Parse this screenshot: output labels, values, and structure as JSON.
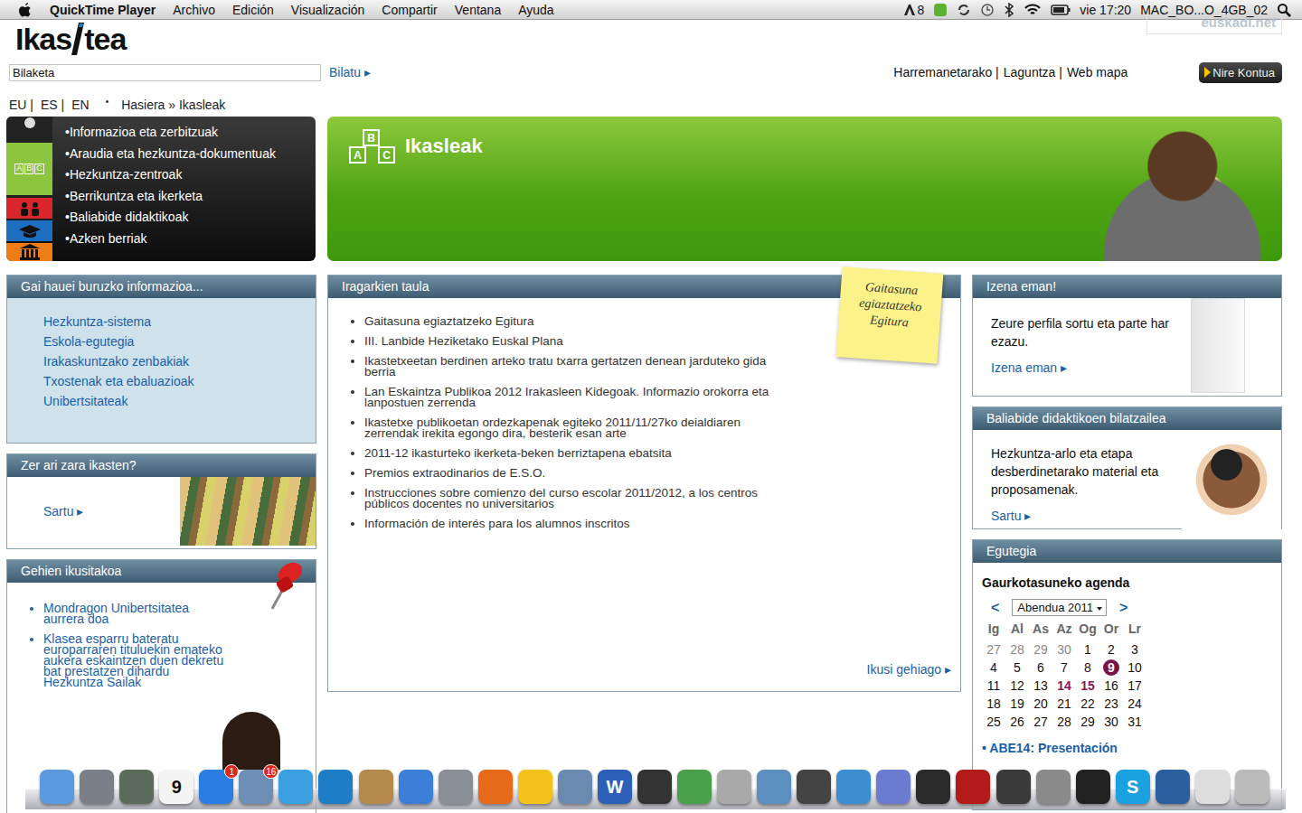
{
  "menubar": {
    "app": "QuickTime Player",
    "menus": [
      "Archivo",
      "Edición",
      "Visualización",
      "Compartir",
      "Ventana",
      "Ayuda"
    ],
    "adobe_count": "8",
    "clock": "vie 17:20",
    "user": "MAC_BO...O_4GB_02"
  },
  "header": {
    "logo_left": "Ikas",
    "logo_right": "tea",
    "partner": "euskadi.net",
    "search_value": "Bilaketa",
    "search_button": "Bilatu ▸",
    "links": [
      "Harremanetarako |",
      "Laguntza |",
      "Web mapa"
    ],
    "account_button": "Nire Kontua"
  },
  "languages": [
    "EU |",
    "ES |",
    "EN"
  ],
  "bullet": "•",
  "breadcrumb": "Hasiera » Ikasleak",
  "nav": [
    "•Informazioa eta zerbitzuak",
    "•Araudia eta hezkuntza-dokumentuak",
    "•Hezkuntza-zentroak",
    "•Berrikuntza eta ikerketa",
    "•Baliabide didaktikoak",
    "•Azken berriak"
  ],
  "banner": {
    "title": "Ikasleak",
    "icon_letters": [
      "A",
      "B",
      "C"
    ]
  },
  "info_panel": {
    "title": "Gai hauei buruzko informazioa...",
    "links": [
      "Hezkuntza-sistema",
      "Eskola-egutegia",
      "Irakaskuntzako zenbakiak",
      "Txostenak eta ebaluazioak",
      "Unibertsitateak"
    ]
  },
  "study_panel": {
    "title": "Zer ari zara ikasten?",
    "link": "Sartu ▸"
  },
  "popular_panel": {
    "title": "Gehien ikusitakoa",
    "links": [
      "Mondragon Unibertsitatea aurrera doa",
      "Klasea esparru bateratu europarraren tituluekin emateko aukera eskaintzen duen dekretu bat prestatzen dihardu Hezkuntza Sailak"
    ]
  },
  "notices": {
    "title": "Iragarkien taula",
    "note": "Gaitasuna egiaztatzeko Egitura",
    "items": [
      "Gaitasuna egiaztatzeko Egitura",
      "III. Lanbide Heziketako Euskal Plana",
      "Ikastetxeetan berdinen arteko tratu txarra gertatzen denean jarduteko gida berria",
      "Lan Eskaintza Publikoa 2012 Irakasleen Kidegoak. Informazio orokorra eta lanpostuen zerrenda",
      "Ikastetxe publikoetan ordezkapenak egiteko 2011/11/27ko deialdiaren zerrendak irekita egongo dira, besterik esan arte",
      "2011-12 ikasturteko ikerketa-beken berriztapena ebatsita",
      "Premios extraodinarios de E.S.O.",
      "Instrucciones sobre comienzo del curso escolar 2011/2012, a los centros públicos docentes no universitarios",
      "Información de interés para los alumnos inscritos"
    ],
    "more": "Ikusi gehiago ▸"
  },
  "signup_panel": {
    "title": "Izena eman!",
    "text": "Zeure perfila sortu eta parte har ezazu.",
    "link": "Izena eman ▸"
  },
  "resources_panel": {
    "title": "Baliabide didaktikoen bilatzailea",
    "text": "Hezkuntza-arlo eta etapa desberdinetarako material eta proposamenak.",
    "link": "Sartu ▸"
  },
  "calendar": {
    "title": "Egutegia",
    "subtitle": "Gaurkotasuneko agenda",
    "month": "Abendua 2011",
    "prev": "<",
    "next": ">",
    "weekdays": [
      "Ig",
      "Al",
      "As",
      "Az",
      "Og",
      "Or",
      "Lr"
    ],
    "weeks": [
      [
        {
          "d": "27",
          "state": "other"
        },
        {
          "d": "28",
          "state": "other"
        },
        {
          "d": "29",
          "state": "other"
        },
        {
          "d": "30",
          "state": "other"
        },
        {
          "d": "1",
          "state": "normal"
        },
        {
          "d": "2",
          "state": "normal"
        },
        {
          "d": "3",
          "state": "normal"
        }
      ],
      [
        {
          "d": "4",
          "state": "normal"
        },
        {
          "d": "5",
          "state": "normal"
        },
        {
          "d": "6",
          "state": "normal"
        },
        {
          "d": "7",
          "state": "normal"
        },
        {
          "d": "8",
          "state": "normal"
        },
        {
          "d": "9",
          "state": "today"
        },
        {
          "d": "10",
          "state": "normal"
        }
      ],
      [
        {
          "d": "11",
          "state": "normal"
        },
        {
          "d": "12",
          "state": "normal"
        },
        {
          "d": "13",
          "state": "normal"
        },
        {
          "d": "14",
          "state": "event"
        },
        {
          "d": "15",
          "state": "event"
        },
        {
          "d": "16",
          "state": "normal"
        },
        {
          "d": "17",
          "state": "normal"
        }
      ],
      [
        {
          "d": "18",
          "state": "normal"
        },
        {
          "d": "19",
          "state": "normal"
        },
        {
          "d": "20",
          "state": "normal"
        },
        {
          "d": "21",
          "state": "normal"
        },
        {
          "d": "22",
          "state": "normal"
        },
        {
          "d": "23",
          "state": "normal"
        },
        {
          "d": "24",
          "state": "normal"
        }
      ],
      [
        {
          "d": "25",
          "state": "normal"
        },
        {
          "d": "26",
          "state": "normal"
        },
        {
          "d": "27",
          "state": "normal"
        },
        {
          "d": "28",
          "state": "normal"
        },
        {
          "d": "29",
          "state": "normal"
        },
        {
          "d": "30",
          "state": "normal"
        },
        {
          "d": "31",
          "state": "normal"
        }
      ]
    ],
    "events": [
      "ABE14: Presentación"
    ]
  },
  "dock": [
    {
      "color": "#5a9be0"
    },
    {
      "color": "#7a7f88"
    },
    {
      "color": "#5d6b5d"
    },
    {
      "color": "#f4f4f4",
      "glyph": "9"
    },
    {
      "color": "#2a7de1",
      "badge": "1"
    },
    {
      "color": "#6e8fb5",
      "badge": "16"
    },
    {
      "color": "#3aa0e0"
    },
    {
      "color": "#1d7ec5"
    },
    {
      "color": "#b58a4a"
    },
    {
      "color": "#3c7fd6"
    },
    {
      "color": "#8a8f96"
    },
    {
      "color": "#e66a1a"
    },
    {
      "color": "#f2c31a"
    },
    {
      "color": "#6a8ab0"
    },
    {
      "color": "#2b5fb8",
      "glyph": "W"
    },
    {
      "color": "#333333"
    },
    {
      "color": "#4aa04a"
    },
    {
      "color": "#a9a9a9"
    },
    {
      "color": "#5a8fc0"
    },
    {
      "color": "#444444"
    },
    {
      "color": "#3b8fd0"
    },
    {
      "color": "#6b7bd0"
    },
    {
      "color": "#2a2a2a"
    },
    {
      "color": "#b31b1b"
    },
    {
      "color": "#3a3a3a"
    },
    {
      "color": "#8a8a8a"
    },
    {
      "color": "#222222"
    },
    {
      "color": "#1aa2e0",
      "glyph": "S"
    },
    {
      "color": "#2a5fa0"
    },
    {
      "color": "#dddddd"
    },
    {
      "color": "#bbbbbb"
    }
  ]
}
